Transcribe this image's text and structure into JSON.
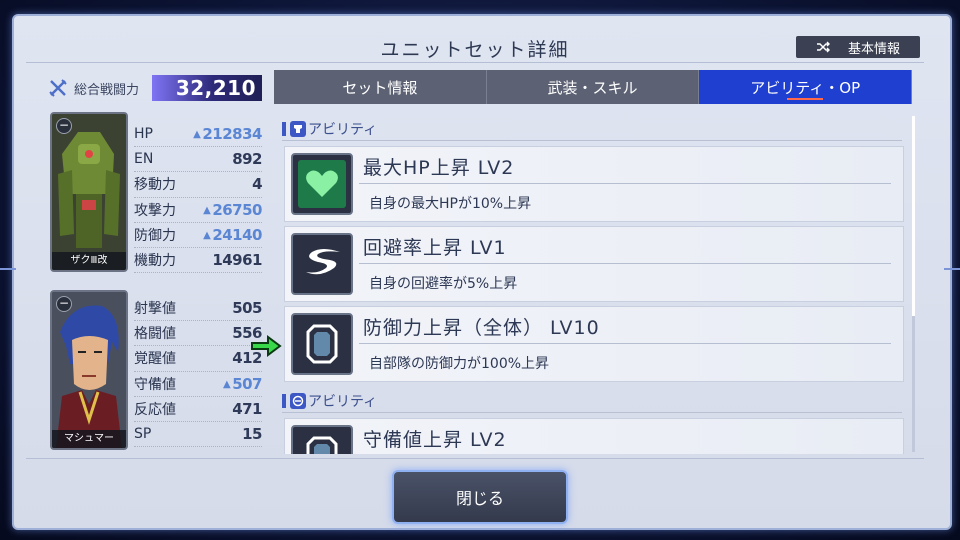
{
  "header": {
    "title": "ユニットセット詳細",
    "kihon_label": "基本情報"
  },
  "combat_power": {
    "label": "総合戦闘力",
    "value": "32,210"
  },
  "unit": {
    "name": "ザクⅢ改",
    "stats": [
      {
        "label": "HP",
        "value": "212834",
        "boost": true
      },
      {
        "label": "EN",
        "value": "892",
        "boost": false
      },
      {
        "label": "移動力",
        "value": "4",
        "boost": false
      },
      {
        "label": "攻撃力",
        "value": "26750",
        "boost": true
      },
      {
        "label": "防御力",
        "value": "24140",
        "boost": true
      },
      {
        "label": "機動力",
        "value": "14961",
        "boost": false
      }
    ]
  },
  "pilot": {
    "name": "マシュマー",
    "stats": [
      {
        "label": "射撃値",
        "value": "505",
        "boost": false
      },
      {
        "label": "格闘値",
        "value": "556",
        "boost": false
      },
      {
        "label": "覚醒値",
        "value": "412",
        "boost": false
      },
      {
        "label": "守備値",
        "value": "507",
        "boost": true
      },
      {
        "label": "反応値",
        "value": "471",
        "boost": false
      },
      {
        "label": "SP",
        "value": "15",
        "boost": false
      }
    ]
  },
  "tabs": [
    {
      "label": "セット情報",
      "active": false
    },
    {
      "label": "武装・スキル",
      "active": false
    },
    {
      "label": "アビリティ・OP",
      "active": true
    }
  ],
  "sections": [
    {
      "label": "アビリティ",
      "icon": "unit-icon"
    },
    {
      "label": "アビリティ",
      "icon": "pilot-icon"
    }
  ],
  "abilities": [
    {
      "title": "最大HP上昇 LV2",
      "desc": "自身の最大HPが10%上昇",
      "icon": "heart-icon"
    },
    {
      "title": "回避率上昇 LV1",
      "desc": "自身の回避率が5%上昇",
      "icon": "swoosh-icon"
    },
    {
      "title": "防御力上昇（全体） LV10",
      "desc": "自部隊の防御力が100%上昇",
      "icon": "shield-icon"
    },
    {
      "title": "守備値上昇 LV2",
      "desc": "",
      "icon": "shield-icon"
    }
  ],
  "footer": {
    "close_label": "閉じる"
  },
  "colors": {
    "accent": "#1f3fd0",
    "boost": "#5b86d4",
    "cp_bar": "#7f74f4",
    "heart": "#6fe08a"
  }
}
